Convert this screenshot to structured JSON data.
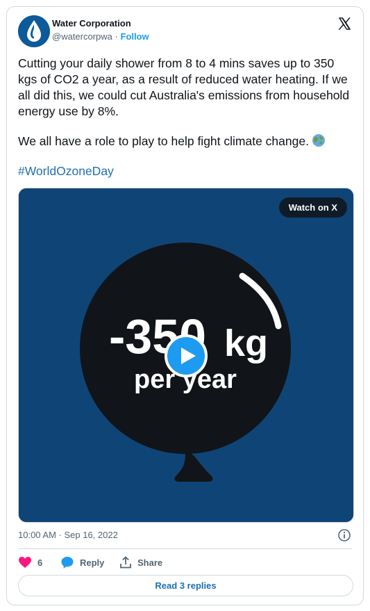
{
  "author": {
    "name": "Water Corporation",
    "handle": "@watercorpwa",
    "separator": "·",
    "follow_label": "Follow",
    "avatar_icon": "water-drop-logo"
  },
  "platform_icon": "x-logo",
  "tweet": {
    "paragraph1": "Cutting your daily shower from 8 to 4 mins saves up to 350 kgs of CO2 a year, as a result of reduced water heating. If we all did this, we could cut Australia's emissions from household energy use by 8%.",
    "paragraph2": "We all have a role to play to help fight climate change.",
    "paragraph2_emoji": "globe-icon",
    "hashtag": "#WorldOzoneDay"
  },
  "media": {
    "watch_label": "Watch on X",
    "overlay_number": "-350",
    "overlay_unit": "kg",
    "overlay_subtitle": "per year",
    "background_color": "#0f4477"
  },
  "footer": {
    "timestamp": "10:00 AM · Sep 16, 2022",
    "like_count": "6",
    "reply_label": "Reply",
    "share_label": "Share",
    "read_replies_label": "Read 3 replies"
  },
  "colors": {
    "accent_blue": "#1d9bf0",
    "link_blue": "#1d6fb0",
    "like_pink": "#f91880",
    "muted_text": "#536471"
  }
}
